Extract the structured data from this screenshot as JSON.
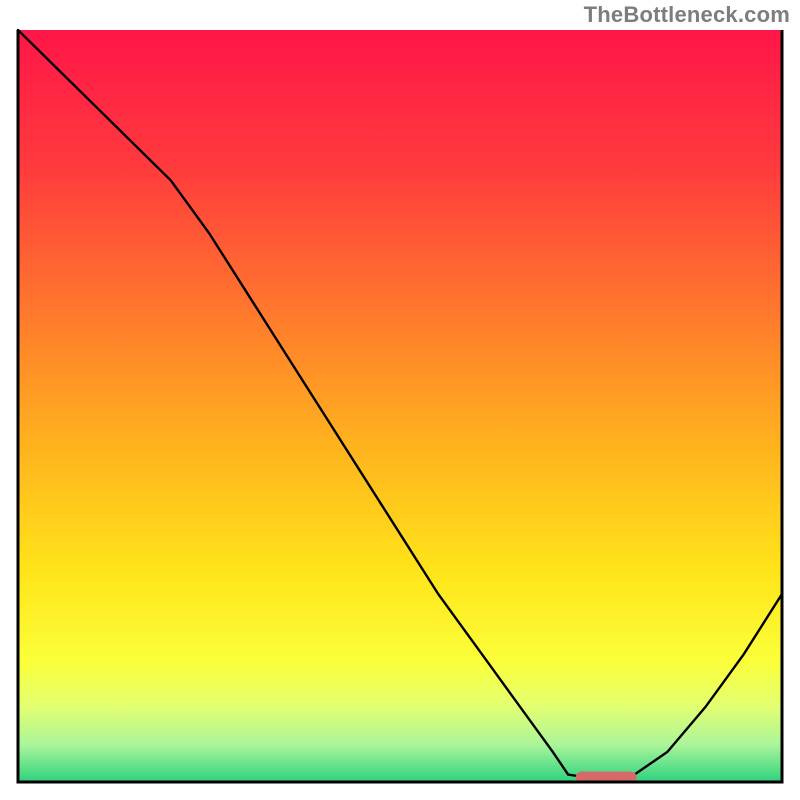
{
  "watermark": "TheBottleneck.com",
  "colors": {
    "curve": "#000000",
    "marker": "#d66a6a",
    "frame": "#000000"
  },
  "gradient_stops": [
    {
      "offset": 0.0,
      "color": "#ff1648"
    },
    {
      "offset": 0.18,
      "color": "#ff3a3d"
    },
    {
      "offset": 0.38,
      "color": "#ff7a2d"
    },
    {
      "offset": 0.55,
      "color": "#ffb21e"
    },
    {
      "offset": 0.72,
      "color": "#ffe41a"
    },
    {
      "offset": 0.84,
      "color": "#fbff3a"
    },
    {
      "offset": 0.9,
      "color": "#e2ff72"
    },
    {
      "offset": 0.95,
      "color": "#abf59a"
    },
    {
      "offset": 1.0,
      "color": "#2dd27f"
    }
  ],
  "chart_data": {
    "type": "line",
    "title": "",
    "xlabel": "",
    "ylabel": "",
    "xlim": [
      0,
      100
    ],
    "ylim": [
      0,
      100
    ],
    "x": [
      0,
      5,
      10,
      15,
      20,
      25,
      30,
      35,
      40,
      45,
      50,
      55,
      60,
      65,
      70,
      72,
      75,
      80,
      85,
      90,
      95,
      100
    ],
    "series": [
      {
        "name": "bottleneck-curve",
        "values": [
          100,
          95,
          90,
          85,
          80,
          73,
          65,
          57,
          49,
          41,
          33,
          25,
          18,
          11,
          4,
          1,
          0.5,
          0.5,
          4,
          10,
          17,
          25
        ]
      }
    ],
    "marker": {
      "x_center": 77,
      "x_half_width": 4,
      "y": 0.6
    }
  }
}
